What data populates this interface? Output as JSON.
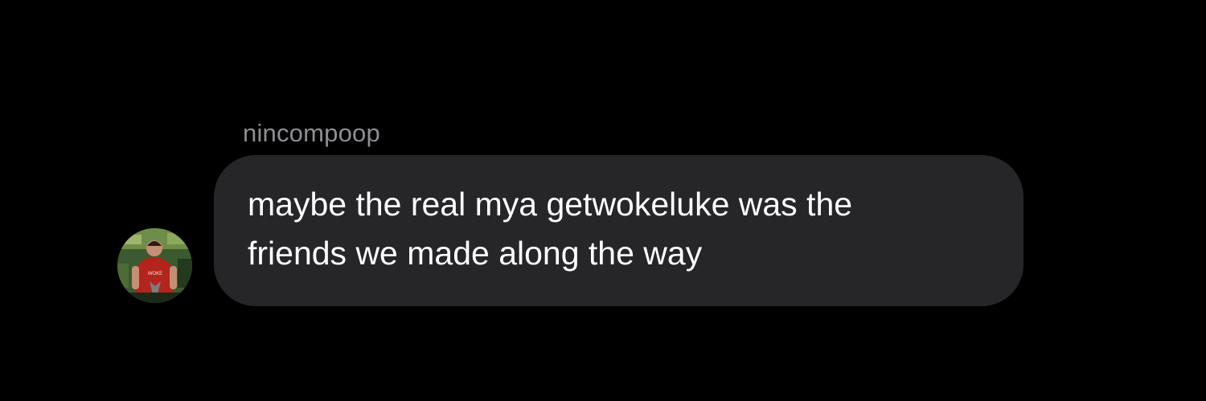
{
  "message": {
    "sender": "nincompoop",
    "text": "maybe the real mya getwokeluke was the\nfriends we made along the way",
    "avatar_icon": "profile-photo-avatar",
    "avatar_shirt_text": "WOKE"
  },
  "colors": {
    "background": "#000000",
    "bubble": "#262629",
    "sender_name": "#8e8e93",
    "message_text": "#ffffff"
  }
}
